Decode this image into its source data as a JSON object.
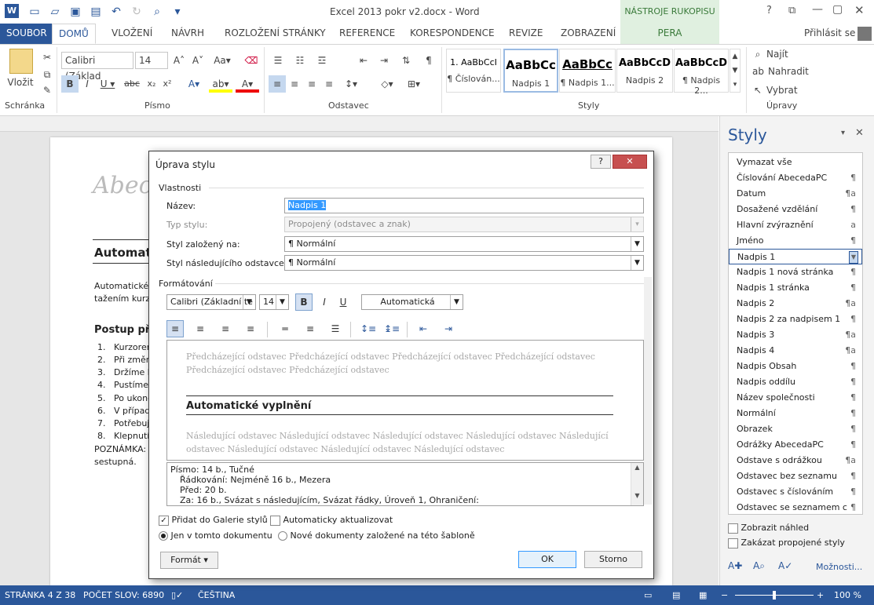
{
  "title": "Excel 2013 pokr v2.docx - Word",
  "context_tab": "NÁSTROJE RUKOPISU",
  "context_tab_sub": "PERA",
  "signin": "Přihlásit se",
  "tabs": [
    "SOUBOR",
    "DOMŮ",
    "VLOŽENÍ",
    "NÁVRH",
    "ROZLOŽENÍ STRÁNKY",
    "REFERENCE",
    "KORESPONDENCE",
    "REVIZE",
    "ZOBRAZENÍ"
  ],
  "ribbon": {
    "paste_label": "Vložit",
    "font_name": "Calibri (Základ",
    "font_size": "14",
    "groups": {
      "clipboard": "Schránka",
      "font": "Písmo",
      "paragraph": "Odstavec",
      "styles": "Styly",
      "editing": "Úpravy"
    },
    "styles_gallery": [
      {
        "sample": "1. AaBbCcI",
        "name": "¶ Číslován..."
      },
      {
        "sample": "AaBbCc",
        "name": "Nadpis 1"
      },
      {
        "sample": "AaBbCc",
        "name": "¶ Nadpis 1..."
      },
      {
        "sample": "AaBbCcD",
        "name": "Nadpis 2"
      },
      {
        "sample": "AaBbCcD",
        "name": "¶ Nadpis 2..."
      }
    ],
    "find": "Najít",
    "replace": "Nahradit",
    "select": "Vybrat"
  },
  "document": {
    "logo_text": "Abece",
    "heading": "Automat",
    "para1": "Automatické",
    "para1b": "tažením kurz",
    "subheading": "Postup při",
    "list": [
      "Kurzorem",
      "Při změn",
      "Držíme le",
      "Pustíme",
      "Po ukonč",
      "V případ",
      "Potřebuj",
      "Klepnutí"
    ],
    "note": "POZNÁMKA:",
    "note2": "sestupná."
  },
  "pane": {
    "title": "Styly",
    "clear": "Vymazat vše",
    "items": [
      {
        "name": "Číslování AbecedaPC",
        "mark": "¶"
      },
      {
        "name": "Datum",
        "mark": "¶a"
      },
      {
        "name": "Dosažené vzdělání",
        "mark": "¶"
      },
      {
        "name": "Hlavní zvýraznění",
        "mark": "a"
      },
      {
        "name": "Jméno",
        "mark": "¶"
      },
      {
        "name": "Nadpis 1",
        "mark": "▼"
      },
      {
        "name": "Nadpis 1 nová stránka",
        "mark": "¶"
      },
      {
        "name": "Nadpis 1 stránka",
        "mark": "¶"
      },
      {
        "name": "Nadpis 2",
        "mark": "¶a"
      },
      {
        "name": "Nadpis 2 za nadpisem 1",
        "mark": "¶"
      },
      {
        "name": "Nadpis 3",
        "mark": "¶a"
      },
      {
        "name": "Nadpis 4",
        "mark": "¶a"
      },
      {
        "name": "Nadpis Obsah",
        "mark": "¶"
      },
      {
        "name": "Nadpis oddílu",
        "mark": "¶"
      },
      {
        "name": "Název společnosti",
        "mark": "¶"
      },
      {
        "name": "Normální",
        "mark": "¶"
      },
      {
        "name": "Obrazek",
        "mark": "¶"
      },
      {
        "name": "Odrážky AbecedaPC",
        "mark": "¶"
      },
      {
        "name": "Odstave s odrážkou",
        "mark": "¶a"
      },
      {
        "name": "Odstavec bez seznamu",
        "mark": "¶"
      },
      {
        "name": "Odstavec s číslováním",
        "mark": "¶"
      },
      {
        "name": "Odstavec se seznamem c",
        "mark": "¶"
      }
    ],
    "show_preview": "Zobrazit náhled",
    "disable_linked": "Zakázat propojené styly",
    "options": "Možnosti..."
  },
  "dialog": {
    "title": "Úprava stylu",
    "help": "?",
    "close": "✕",
    "properties": "Vlastnosti",
    "name_label": "Název:",
    "name_value": "Nadpis 1",
    "type_label": "Typ stylu:",
    "type_value": "Propojený (odstavec a znak)",
    "based_label": "Styl založený na:",
    "based_value": "¶  Normální",
    "next_label": "Styl následujícího odstavce:",
    "next_value": "¶  Normální",
    "formatting": "Formátování",
    "font": "Calibri (Základní te",
    "size": "14",
    "bold": "B",
    "italic": "I",
    "underline": "U",
    "color": "Automatická",
    "preview_prev": "Předcházející odstavec Předcházející odstavec Předcházející odstavec Předcházející odstavec Předcházející odstavec Předcházející odstavec",
    "preview_heading": "Automatické vyplnění",
    "preview_next": "Následující odstavec Následující odstavec Následující odstavec Následující odstavec Následující odstavec Následující odstavec Následující odstavec Následující odstavec",
    "desc1": "Písmo: 14 b., Tučné",
    "desc2": "Řádkování:  Nejméně 16 b., Mezera",
    "desc3": "Před:  20 b.",
    "desc4": "Za:  16 b., Svázat s následujícím, Svázat řádky, Úroveň 1, Ohraničení:",
    "add_gallery": "Přidat do Galerie stylů",
    "auto_update": "Automaticky aktualizovat",
    "only_doc": "Jen v tomto dokumentu",
    "new_docs": "Nové dokumenty založené na této šabloně",
    "format_btn": "Formát ▾",
    "ok": "OK",
    "cancel": "Storno"
  },
  "status": {
    "page": "STRÁNKA 4 Z 38",
    "words": "POČET SLOV: 6890",
    "lang": "ČEŠTINA",
    "zoom": "100 %"
  }
}
